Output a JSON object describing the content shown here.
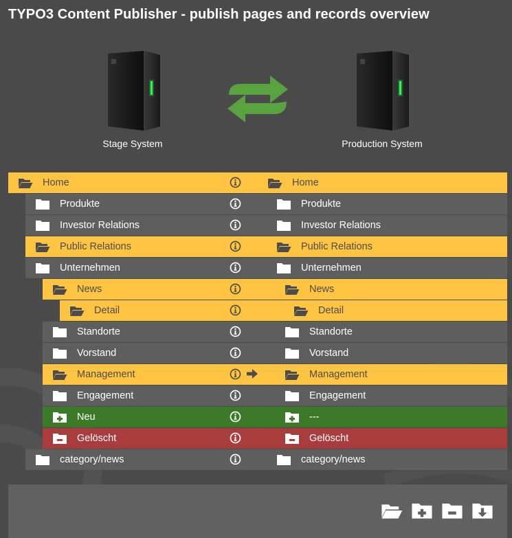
{
  "app": {
    "title": "TYPO3 Content Publisher - publish pages and records overview"
  },
  "systems": {
    "stage_label": "Stage System",
    "production_label": "Production System"
  },
  "tree": [
    {
      "stage": "Home",
      "prod": "Home",
      "state": "mod",
      "indent": 0,
      "folder": "open"
    },
    {
      "stage": "Produkte",
      "prod": "Produkte",
      "state": "same",
      "indent": 1,
      "folder": "closed"
    },
    {
      "stage": "Investor Relations",
      "prod": "Investor Relations",
      "state": "same",
      "indent": 1,
      "folder": "closed"
    },
    {
      "stage": "Public Relations",
      "prod": "Public Relations",
      "state": "mod",
      "indent": 1,
      "folder": "open"
    },
    {
      "stage": "Unternehmen",
      "prod": "Unternehmen",
      "state": "same",
      "indent": 1,
      "folder": "closed"
    },
    {
      "stage": "News",
      "prod": "News",
      "state": "mod",
      "indent": 2,
      "folder": "open"
    },
    {
      "stage": "Detail",
      "prod": "Detail",
      "state": "mod",
      "indent": 3,
      "folder": "open"
    },
    {
      "stage": "Standorte",
      "prod": "Standorte",
      "state": "same",
      "indent": 2,
      "folder": "closed"
    },
    {
      "stage": "Vorstand",
      "prod": "Vorstand",
      "state": "same",
      "indent": 2,
      "folder": "closed"
    },
    {
      "stage": "Management",
      "prod": "Management",
      "state": "mod",
      "indent": 2,
      "folder": "open",
      "arrow": true
    },
    {
      "stage": "Engagement",
      "prod": "Engagement",
      "state": "same",
      "indent": 2,
      "folder": "closed"
    },
    {
      "stage": "Neu",
      "prod": "---",
      "state": "new",
      "indent": 2,
      "folder": "plus"
    },
    {
      "stage": "Gelöscht",
      "prod": "Gelöscht",
      "state": "del",
      "indent": 2,
      "folder": "minus"
    },
    {
      "stage": "category/news",
      "prod": "category/news",
      "state": "same",
      "indent": 1,
      "folder": "closed"
    }
  ],
  "footer": {
    "buttons": [
      {
        "name": "expand-all-button",
        "icon": "folder-open-icon"
      },
      {
        "name": "add-page-button",
        "icon": "folder-plus-icon"
      },
      {
        "name": "remove-page-button",
        "icon": "folder-minus-icon"
      },
      {
        "name": "publish-button",
        "icon": "folder-download-icon"
      }
    ]
  }
}
